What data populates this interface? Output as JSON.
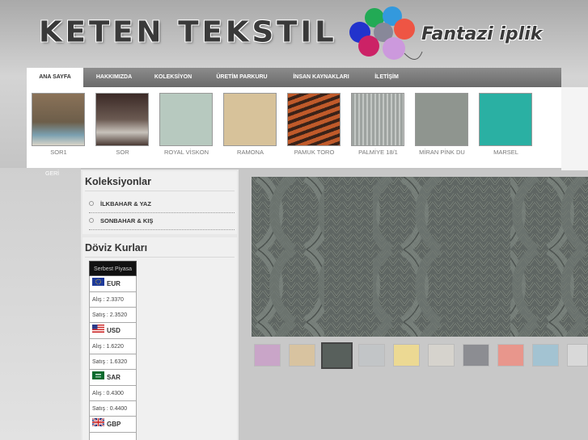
{
  "header": {
    "logo_text": "KETEN TEKSTIL",
    "tagline": "Fantazi iplik"
  },
  "nav": {
    "items": [
      {
        "label": "ANA SAYFA",
        "active": true
      },
      {
        "label": "HAKKIMIZDA",
        "active": false
      },
      {
        "label": "KOLEKSİYON",
        "active": false
      },
      {
        "label": "ÜRETİM PARKURU",
        "active": false
      },
      {
        "label": "İNSAN KAYNAKLARI",
        "active": false
      },
      {
        "label": "İLETİŞİM",
        "active": false
      }
    ]
  },
  "products": [
    {
      "label": "SOR1",
      "color": "#7a6a55"
    },
    {
      "label": "SOR",
      "color": "#4a3a34"
    },
    {
      "label": "ROYAL VİSKON",
      "color": "#b7c9bf"
    },
    {
      "label": "RAMONA",
      "color": "#d7c29a"
    },
    {
      "label": "PAMUK TORO",
      "color": "#b0542c"
    },
    {
      "label": "PALMİYE 18/1",
      "color": "#9ea3a0"
    },
    {
      "label": "MİRAN PİNK DU",
      "color": "#8f958f"
    },
    {
      "label": "MARSEL",
      "color": "#2ab0a3"
    }
  ],
  "back_label": "GERİ",
  "sidebar": {
    "collections_title": "Koleksiyonlar",
    "categories": [
      "İLKBAHAR & YAZ",
      "SONBAHAR & KIŞ"
    ],
    "currency_title": "Döviz Kurları",
    "currency_header": "Serbest Piyasa",
    "currencies": [
      {
        "code": "EUR",
        "flag": "eu-flag-icon",
        "buy": "Alış      : 2.3370",
        "sell": "Satış    : 2.3520"
      },
      {
        "code": "USD",
        "flag": "us-flag-icon",
        "buy": "Alış      : 1.6220",
        "sell": "Satış    : 1.6320"
      },
      {
        "code": "SAR",
        "flag": "sa-flag-icon",
        "buy": "Alış      : 0.4300",
        "sell": "Satış    : 0.4400"
      },
      {
        "code": "GBP",
        "flag": "gb-flag-icon",
        "buy": "",
        "sell": ""
      }
    ]
  },
  "thumbs": [
    {
      "color": "#c9a5c8"
    },
    {
      "color": "#d8c3a0"
    },
    {
      "color": "#58605c",
      "selected": true
    },
    {
      "color": "#c2c5c7"
    },
    {
      "color": "#ecd993"
    },
    {
      "color": "#d6d3cd"
    },
    {
      "color": "#8c8d92"
    },
    {
      "color": "#e8968c"
    },
    {
      "color": "#a3c3d2"
    },
    {
      "color": "#d9d9d9"
    }
  ]
}
